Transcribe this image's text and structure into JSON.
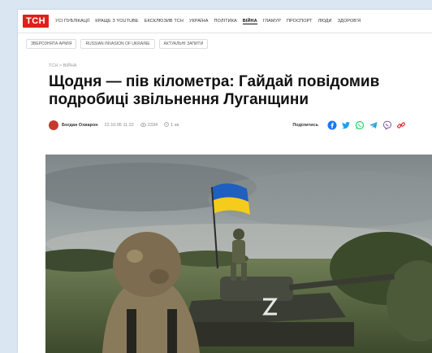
{
  "site": {
    "logo": "ТСН"
  },
  "nav": [
    {
      "label": "УСІ ПУБЛІКАЦІЇ"
    },
    {
      "label": "КРАЩЕ З YOUTUBE"
    },
    {
      "label": "ЕКСКЛЮЗИВ ТСН"
    },
    {
      "label": "УКРАЇНА"
    },
    {
      "label": "ПОЛІТИКА"
    },
    {
      "label": "ВІЙНА"
    },
    {
      "label": "ГЛАМУР"
    },
    {
      "label": "ПРОСПОРТ"
    },
    {
      "label": "ЛЮДИ"
    },
    {
      "label": "ЗДОРОВ'Я"
    }
  ],
  "tags": [
    {
      "label": "ЗВЕРОЗНЯТА АРМІЯ"
    },
    {
      "label": "RUSSIAN INVASION OF UKRAINE"
    },
    {
      "label": "АКТУАЛЬНІ ЗАПИТИ"
    }
  ],
  "breadcrumb": "ТСН > ВІЙНА",
  "article": {
    "title": "Щодня — пів кілометра: Гайдай повідомив подробиці звільнення Луганщини",
    "author": "Богдан Охварон",
    "date": "22.10.05 11:22",
    "views": "2334",
    "read_time": "1 хв"
  },
  "share": {
    "label": "Поділитись",
    "icons": [
      "facebook-icon",
      "twitter-icon",
      "whatsapp-icon",
      "telegram-icon",
      "viber-icon",
      "link-icon"
    ]
  },
  "colors": {
    "brand_red": "#e0201b",
    "facebook": "#1877f2",
    "twitter": "#1da1f2",
    "whatsapp": "#25d366",
    "telegram": "#2aa3d6",
    "viber": "#7d4ea3",
    "link": "#e0201b"
  }
}
